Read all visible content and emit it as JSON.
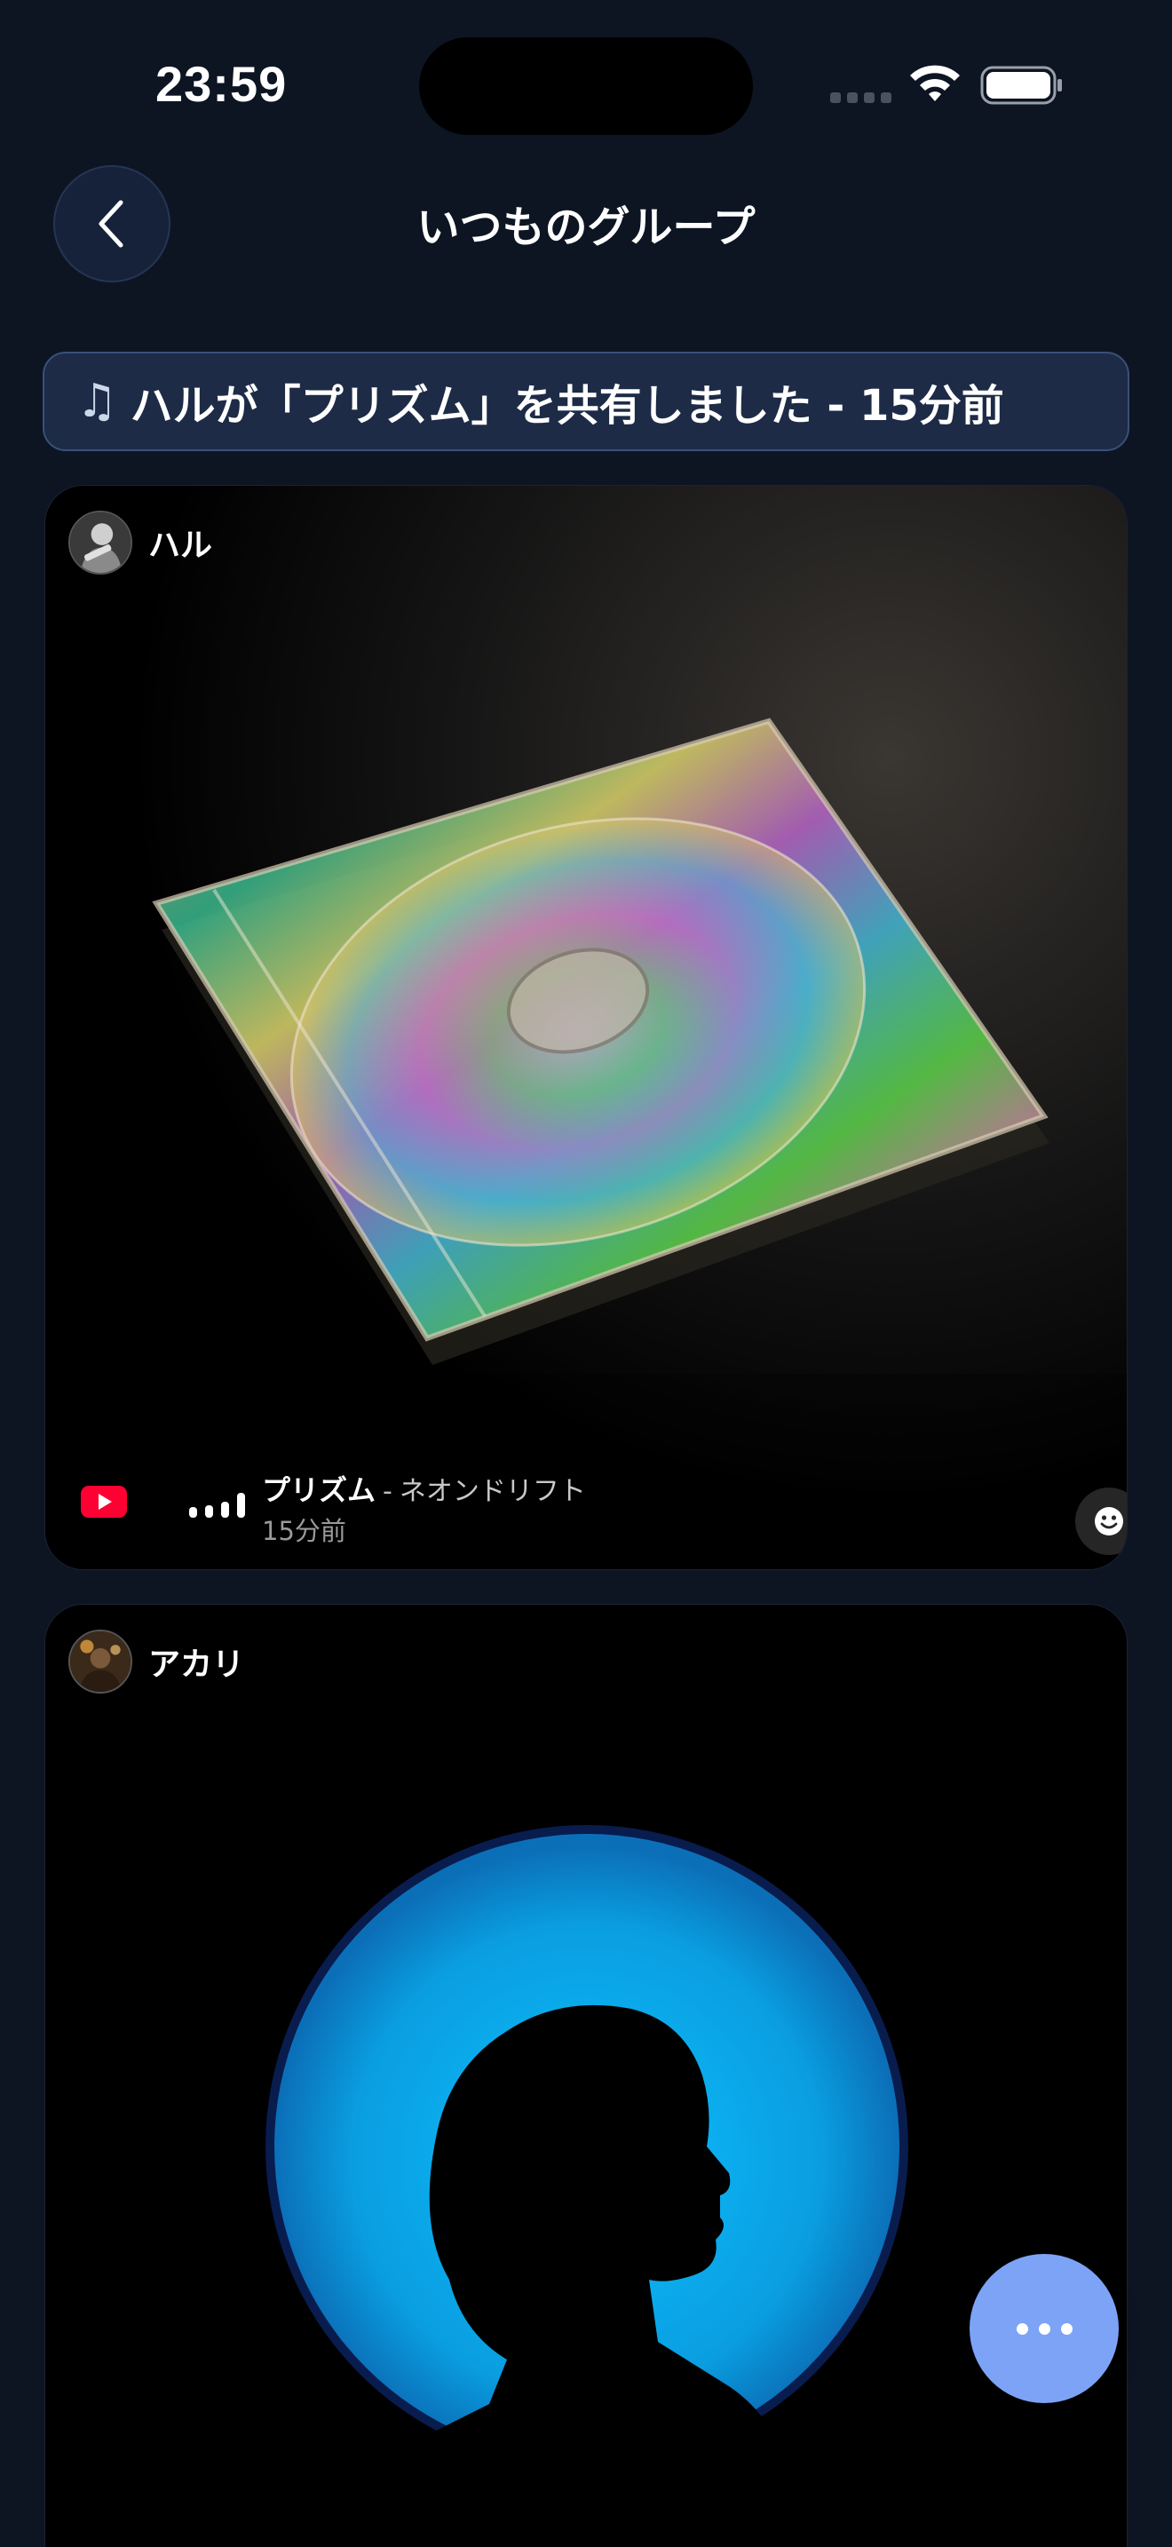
{
  "status_bar": {
    "time": "23:59"
  },
  "header": {
    "title": "いつものグループ",
    "back_icon": "chevron-left-icon"
  },
  "banner": {
    "icon": "music-note-icon",
    "text": "ハルが「プリズム」を共有しました - 15分前"
  },
  "posts": [
    {
      "user": "ハル",
      "image": "iridescent-cd-case",
      "source_icon": "youtube-icon",
      "track_title": "プリズム",
      "separator": "-",
      "artist": "ネオンドリフト",
      "time_ago": "15分前"
    },
    {
      "user": "アカリ",
      "image": "silhouette-blue-circle"
    }
  ],
  "fab": {
    "icon": "more-icon"
  },
  "colors": {
    "background": "#0d1523",
    "banner": "#1d2b47",
    "fab": "#7ca3f6",
    "youtube": "#ff0033"
  }
}
